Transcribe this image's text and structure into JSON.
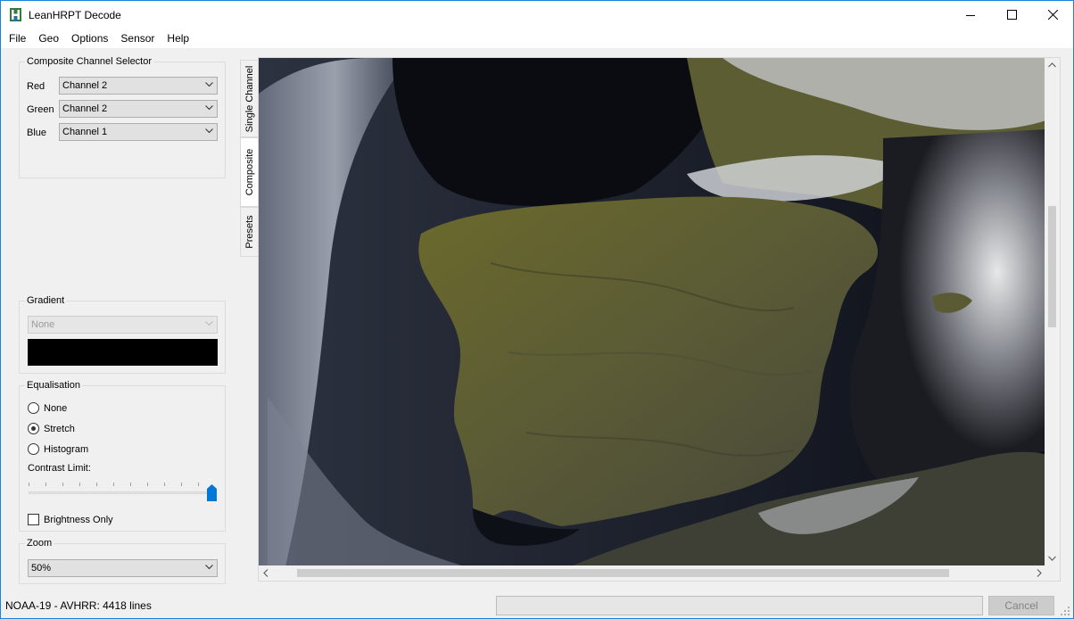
{
  "window": {
    "title": "LeanHRPT Decode",
    "accent_color": "#1883d7",
    "controls": [
      "minimize-icon",
      "maximize-icon",
      "close-icon"
    ]
  },
  "menubar": {
    "items": [
      "File",
      "Geo",
      "Options",
      "Sensor",
      "Help"
    ]
  },
  "composite": {
    "title": "Composite Channel Selector",
    "red_label": "Red",
    "red_value": "Channel 2",
    "green_label": "Green",
    "green_value": "Channel 2",
    "blue_label": "Blue",
    "blue_value": "Channel 1"
  },
  "tabs": {
    "items": [
      "Single Channel",
      "Composite",
      "Presets"
    ],
    "active": "Composite"
  },
  "gradient": {
    "title": "Gradient",
    "value": "None",
    "swatch_color": "#000000"
  },
  "equalisation": {
    "title": "Equalisation",
    "options": [
      "None",
      "Stretch",
      "Histogram"
    ],
    "selected": "Stretch",
    "contrast_label": "Contrast Limit:",
    "contrast_level": 1.0,
    "brightness_label": "Brightness Only",
    "brightness_checked": false
  },
  "zoom": {
    "title": "Zoom",
    "value": "50%"
  },
  "viewer": {
    "content": "satellite-composite-image"
  },
  "status": {
    "text": "NOAA-19 - AVHRR: 4418 lines",
    "cancel_label": "Cancel"
  }
}
